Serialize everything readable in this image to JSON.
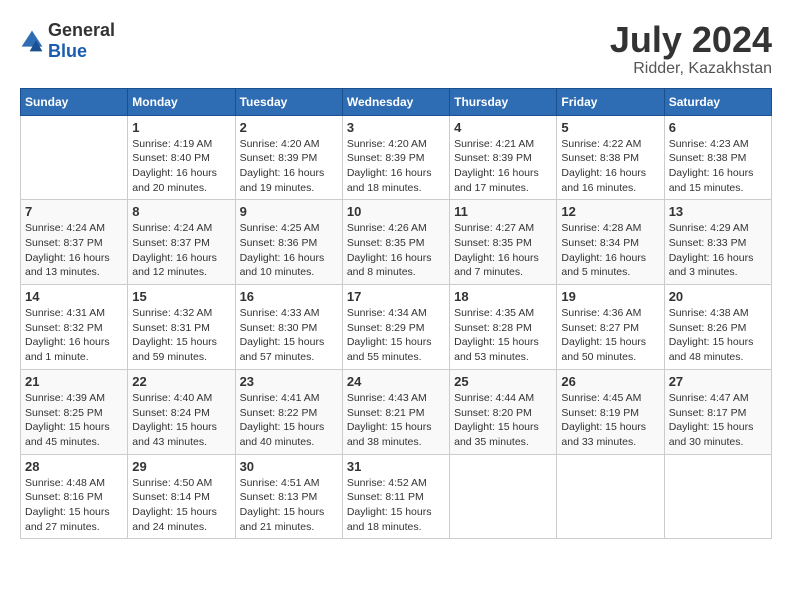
{
  "header": {
    "logo_general": "General",
    "logo_blue": "Blue",
    "month": "July 2024",
    "location": "Ridder, Kazakhstan"
  },
  "weekdays": [
    "Sunday",
    "Monday",
    "Tuesday",
    "Wednesday",
    "Thursday",
    "Friday",
    "Saturday"
  ],
  "weeks": [
    [
      {
        "day": "",
        "text": ""
      },
      {
        "day": "1",
        "text": "Sunrise: 4:19 AM\nSunset: 8:40 PM\nDaylight: 16 hours\nand 20 minutes."
      },
      {
        "day": "2",
        "text": "Sunrise: 4:20 AM\nSunset: 8:39 PM\nDaylight: 16 hours\nand 19 minutes."
      },
      {
        "day": "3",
        "text": "Sunrise: 4:20 AM\nSunset: 8:39 PM\nDaylight: 16 hours\nand 18 minutes."
      },
      {
        "day": "4",
        "text": "Sunrise: 4:21 AM\nSunset: 8:39 PM\nDaylight: 16 hours\nand 17 minutes."
      },
      {
        "day": "5",
        "text": "Sunrise: 4:22 AM\nSunset: 8:38 PM\nDaylight: 16 hours\nand 16 minutes."
      },
      {
        "day": "6",
        "text": "Sunrise: 4:23 AM\nSunset: 8:38 PM\nDaylight: 16 hours\nand 15 minutes."
      }
    ],
    [
      {
        "day": "7",
        "text": "Sunrise: 4:24 AM\nSunset: 8:37 PM\nDaylight: 16 hours\nand 13 minutes."
      },
      {
        "day": "8",
        "text": "Sunrise: 4:24 AM\nSunset: 8:37 PM\nDaylight: 16 hours\nand 12 minutes."
      },
      {
        "day": "9",
        "text": "Sunrise: 4:25 AM\nSunset: 8:36 PM\nDaylight: 16 hours\nand 10 minutes."
      },
      {
        "day": "10",
        "text": "Sunrise: 4:26 AM\nSunset: 8:35 PM\nDaylight: 16 hours\nand 8 minutes."
      },
      {
        "day": "11",
        "text": "Sunrise: 4:27 AM\nSunset: 8:35 PM\nDaylight: 16 hours\nand 7 minutes."
      },
      {
        "day": "12",
        "text": "Sunrise: 4:28 AM\nSunset: 8:34 PM\nDaylight: 16 hours\nand 5 minutes."
      },
      {
        "day": "13",
        "text": "Sunrise: 4:29 AM\nSunset: 8:33 PM\nDaylight: 16 hours\nand 3 minutes."
      }
    ],
    [
      {
        "day": "14",
        "text": "Sunrise: 4:31 AM\nSunset: 8:32 PM\nDaylight: 16 hours\nand 1 minute."
      },
      {
        "day": "15",
        "text": "Sunrise: 4:32 AM\nSunset: 8:31 PM\nDaylight: 15 hours\nand 59 minutes."
      },
      {
        "day": "16",
        "text": "Sunrise: 4:33 AM\nSunset: 8:30 PM\nDaylight: 15 hours\nand 57 minutes."
      },
      {
        "day": "17",
        "text": "Sunrise: 4:34 AM\nSunset: 8:29 PM\nDaylight: 15 hours\nand 55 minutes."
      },
      {
        "day": "18",
        "text": "Sunrise: 4:35 AM\nSunset: 8:28 PM\nDaylight: 15 hours\nand 53 minutes."
      },
      {
        "day": "19",
        "text": "Sunrise: 4:36 AM\nSunset: 8:27 PM\nDaylight: 15 hours\nand 50 minutes."
      },
      {
        "day": "20",
        "text": "Sunrise: 4:38 AM\nSunset: 8:26 PM\nDaylight: 15 hours\nand 48 minutes."
      }
    ],
    [
      {
        "day": "21",
        "text": "Sunrise: 4:39 AM\nSunset: 8:25 PM\nDaylight: 15 hours\nand 45 minutes."
      },
      {
        "day": "22",
        "text": "Sunrise: 4:40 AM\nSunset: 8:24 PM\nDaylight: 15 hours\nand 43 minutes."
      },
      {
        "day": "23",
        "text": "Sunrise: 4:41 AM\nSunset: 8:22 PM\nDaylight: 15 hours\nand 40 minutes."
      },
      {
        "day": "24",
        "text": "Sunrise: 4:43 AM\nSunset: 8:21 PM\nDaylight: 15 hours\nand 38 minutes."
      },
      {
        "day": "25",
        "text": "Sunrise: 4:44 AM\nSunset: 8:20 PM\nDaylight: 15 hours\nand 35 minutes."
      },
      {
        "day": "26",
        "text": "Sunrise: 4:45 AM\nSunset: 8:19 PM\nDaylight: 15 hours\nand 33 minutes."
      },
      {
        "day": "27",
        "text": "Sunrise: 4:47 AM\nSunset: 8:17 PM\nDaylight: 15 hours\nand 30 minutes."
      }
    ],
    [
      {
        "day": "28",
        "text": "Sunrise: 4:48 AM\nSunset: 8:16 PM\nDaylight: 15 hours\nand 27 minutes."
      },
      {
        "day": "29",
        "text": "Sunrise: 4:50 AM\nSunset: 8:14 PM\nDaylight: 15 hours\nand 24 minutes."
      },
      {
        "day": "30",
        "text": "Sunrise: 4:51 AM\nSunset: 8:13 PM\nDaylight: 15 hours\nand 21 minutes."
      },
      {
        "day": "31",
        "text": "Sunrise: 4:52 AM\nSunset: 8:11 PM\nDaylight: 15 hours\nand 18 minutes."
      },
      {
        "day": "",
        "text": ""
      },
      {
        "day": "",
        "text": ""
      },
      {
        "day": "",
        "text": ""
      }
    ]
  ]
}
